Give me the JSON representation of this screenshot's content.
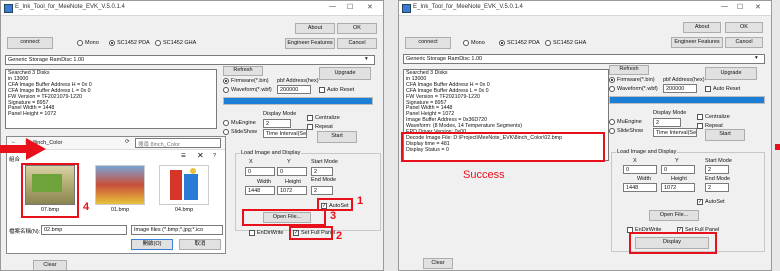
{
  "app": {
    "title": "E_Ink_Tool_for_MeeNote_EVK_V.5.0.1.4",
    "win_min": "—",
    "win_max": "☐",
    "win_close": "✕"
  },
  "left": {
    "connect": "connect",
    "mono": "Mono",
    "sc1452pda": "SC1452 PDA",
    "sc1452gha": "SC1452 GHA",
    "about": "About",
    "ok": "OK",
    "engineer": "Engineer Features",
    "cancel": "Cancel",
    "storage": "Generic Storage RamDisc 1.00",
    "refresh": "Refresh",
    "upgrade": "Upgrade",
    "firmware": "Firmware(*.bin)",
    "firmware_addr_label": "pbf Address(hex)",
    "waveform": "Waveform(*.wbf)",
    "waveform_addr": "200000",
    "auto_reset": "Auto Reset",
    "log_lines": [
      "Searched 3 Disks",
      "in 13000",
      "CFA Image Buffer Address H = 0x  0",
      "CFA Image Buffer Address L = 0x  0",
      "FW Version   = TF2021079-1220",
      "Signature = 8957",
      "Panel Width = 1448",
      "Panel Height = 1072"
    ],
    "display_mode": "Display Mode",
    "mode_value": "2",
    "mu_engine": "MuEngine",
    "centralize": "Centralize",
    "slide_show": "SlideShow",
    "repeat": "Repeat",
    "time_interval": "Time Interval(Secs)",
    "start": "Start",
    "load_image": "Load Image and Display",
    "x": "X",
    "y": "Y",
    "start_mode": "Start Mode",
    "x_val": "0",
    "y_val": "0",
    "sm_val": "2",
    "width": "Width",
    "height": "Height",
    "end_mode": "End Mode",
    "w_val": "1448",
    "h_val": "1072",
    "em_val": "2",
    "auto_set": "AutoSet",
    "open_file": "Open File...",
    "ew_write": "EnDirWrite",
    "set_full_panel": "Set Full Panel",
    "clear": "Clear"
  },
  "dialog": {
    "title": "開啟",
    "path": "8inch_Color",
    "search_placeholder": "搜尋 8inch_Color",
    "left_label": "組合",
    "files": [
      {
        "name": "07.bmp"
      },
      {
        "name": "01.bmp"
      },
      {
        "name": "04.bmp"
      }
    ],
    "filename_label": "檔案名稱(N):",
    "filename": "02.bmp",
    "filter": "Image files (*.bmp;*.jpg;*.ico",
    "open_btn": "開啟(O)",
    "cancel_btn": "取消"
  },
  "annotations": {
    "n1": "1",
    "n2": "2",
    "n3": "3",
    "n4": "4",
    "success": "Success"
  },
  "right": {
    "connect": "connect",
    "mono": "Mono",
    "sc1452pda": "SC1452 PDA",
    "sc1452gha": "SC1452 GHA",
    "about": "About",
    "ok": "OK",
    "engineer": "Engineer Features",
    "cancel": "Cancel",
    "storage": "Generic Storage RamDisc 1.00",
    "refresh": "Refresh",
    "upgrade": "Upgrade",
    "firmware": "Firmware(*.bin)",
    "firmware_addr_label": "pbf Address(hex)",
    "waveform": "Waveform(*.wbf)",
    "waveform_addr": "200000",
    "auto_reset": "Auto Reset",
    "log_lines": [
      "Searched 3 Disks",
      "in 13000",
      "CFA Image Buffer Address H = 0x  0",
      "CFA Image Buffer Address L = 0x  0",
      "FW Version = TF2021079-1220",
      "Signature = 8957",
      "Panel Width = 1448",
      "Panel Height = 1072",
      "Image Buffer Address = 0x36D720",
      "Waveform: (8 Modes, 14 Temperature Segments)",
      "EPD Driver Version: 0x00",
      "Decode Image File: D:\\Project\\MeeNote_EVK\\8inch_Color\\02.bmp",
      "Display time = 481",
      "Display Status = 0"
    ],
    "display_mode": "Display Mode",
    "mode_value": "2",
    "mu_engine": "MuEngine",
    "centralize": "Centralize",
    "slide_show": "SlideShow",
    "repeat": "Repeat",
    "time_interval": "Time Interval(Secs)",
    "start": "Start",
    "load_image": "Load Image and Display",
    "x": "X",
    "y": "Y",
    "start_mode": "Start Mode",
    "x_val": "0",
    "y_val": "0",
    "sm_val": "2",
    "width": "Width",
    "height": "Height",
    "end_mode": "End Mode",
    "w_val": "1448",
    "h_val": "1072",
    "em_val": "2",
    "auto_set": "AutoSet",
    "open_file": "Open File...",
    "ew_write": "EnDirWrite",
    "set_full_panel": "Set Full Panel",
    "display": "Display",
    "clear": "Clear"
  },
  "colors": {
    "annotation_red": "#e8101a",
    "progress_blue": "#1c7fd6"
  }
}
